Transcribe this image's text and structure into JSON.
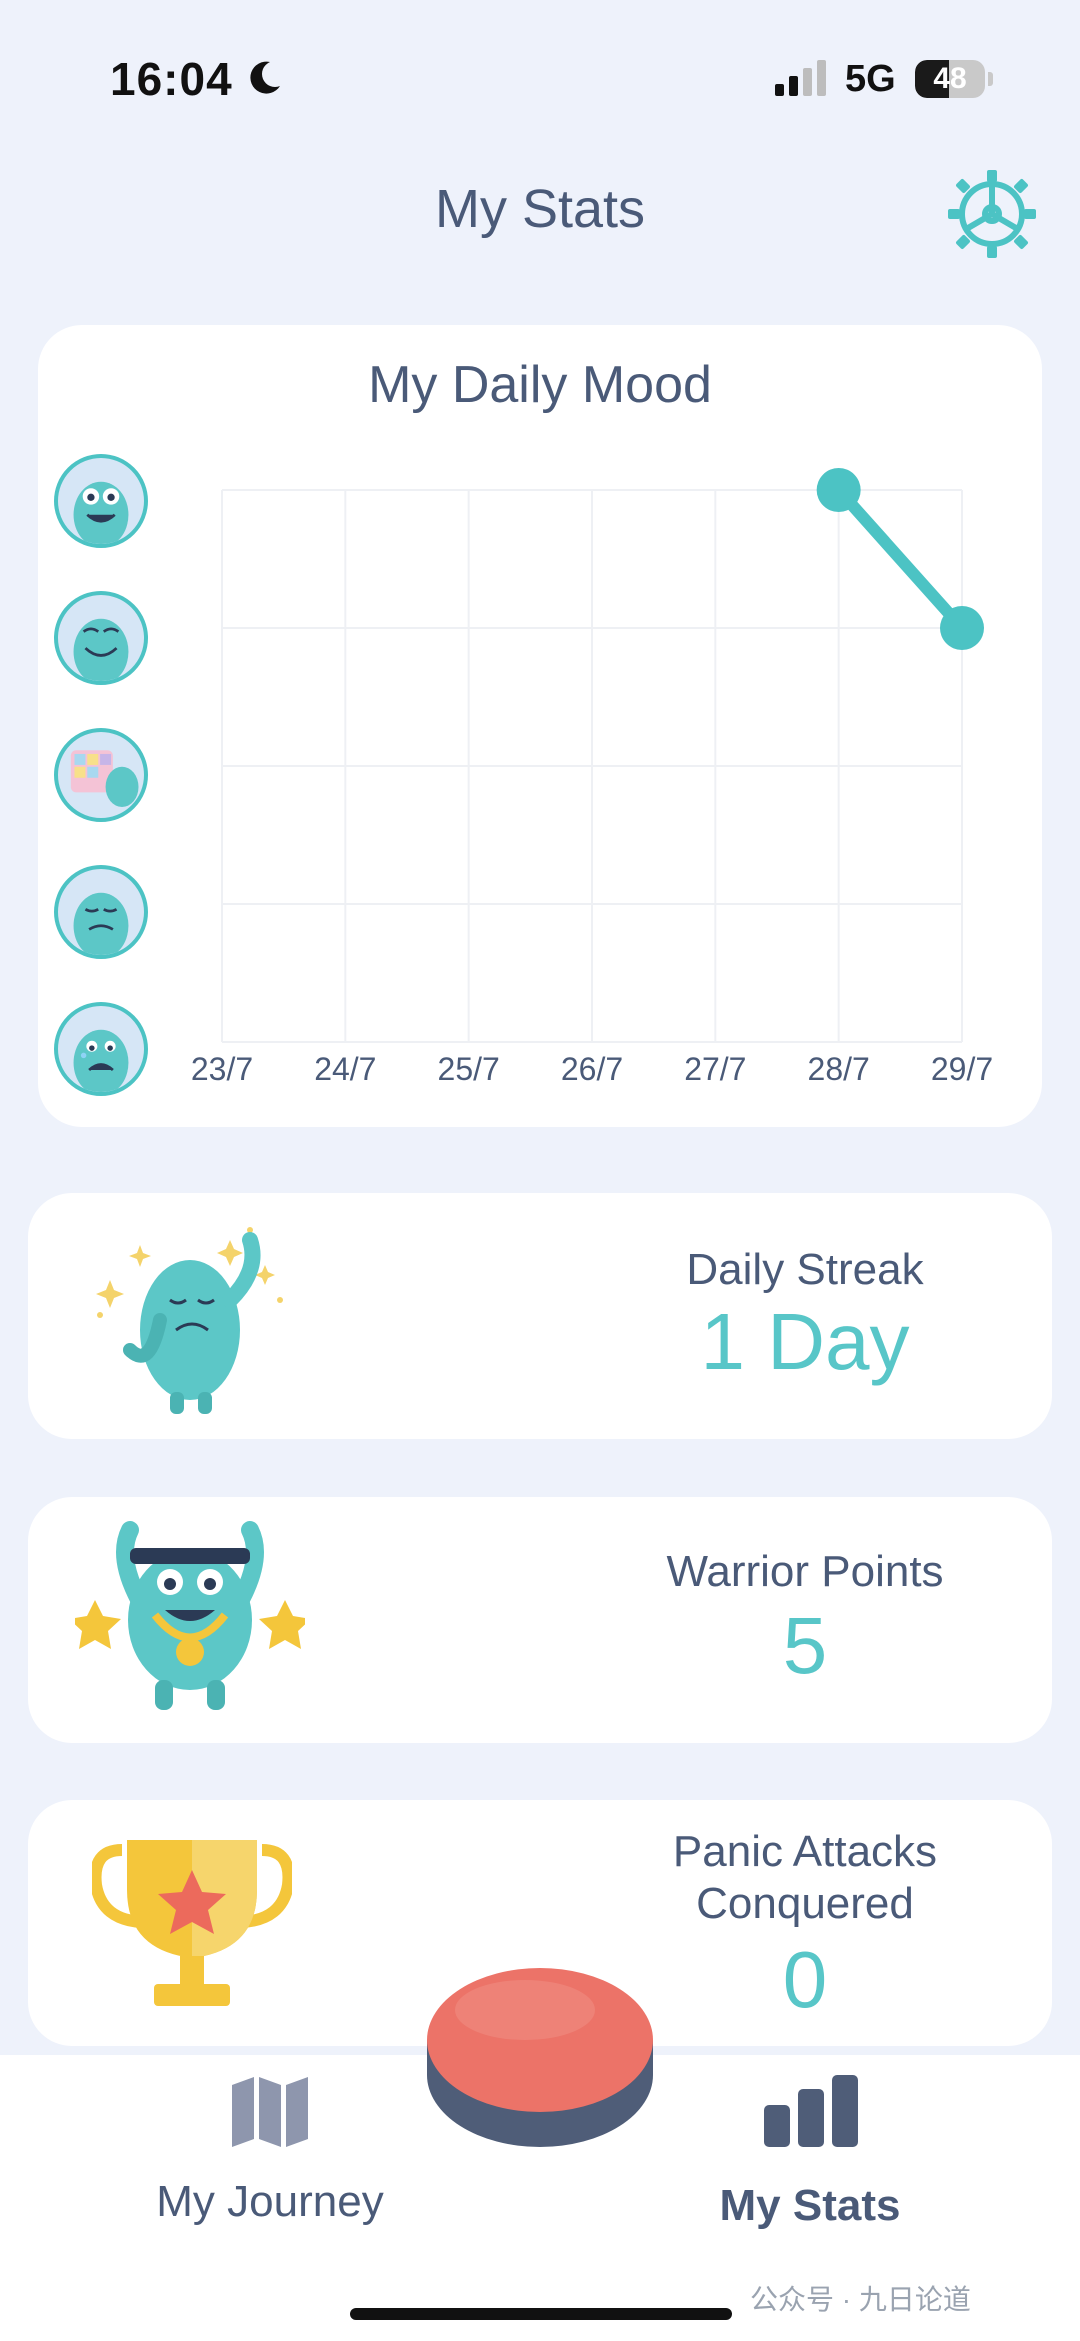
{
  "status_bar": {
    "time": "16:04",
    "network": "5G",
    "battery": "48",
    "battery_level": 0.48
  },
  "header": {
    "title": "My Stats",
    "settings_icon": "gear-icon"
  },
  "mood_card": {
    "title": "My Daily Mood",
    "mood_levels": [
      "mood-very-happy-icon",
      "mood-happy-icon",
      "mood-neutral-icon",
      "mood-sad-icon",
      "mood-very-sad-icon"
    ]
  },
  "chart_data": {
    "type": "line",
    "x": [
      "23/7",
      "24/7",
      "25/7",
      "26/7",
      "27/7",
      "28/7",
      "29/7"
    ],
    "series": [
      {
        "values": [
          null,
          null,
          null,
          null,
          null,
          5,
          4
        ]
      }
    ],
    "ylim": [
      1,
      5
    ],
    "y_labels": "mood icons (5 levels, top = best)",
    "grid": true,
    "color": "#4cc3c4"
  },
  "stats": {
    "streak": {
      "label": "Daily Streak",
      "value": "1 Day"
    },
    "warrior": {
      "label": "Warrior Points",
      "value": "5"
    },
    "panic": {
      "label_line1": "Panic Attacks",
      "label_line2": "Conquered",
      "value": "0"
    }
  },
  "nav": {
    "journey_label": "My Journey",
    "stats_label": "My Stats",
    "active": "stats"
  },
  "watermark": "公众号 · 九日论道",
  "colors": {
    "accent": "#4cc3c4",
    "text": "#4a5a78",
    "panic_button_top": "#ec7368",
    "panic_button_base": "#4f5d78",
    "background": "#eef2fb"
  }
}
